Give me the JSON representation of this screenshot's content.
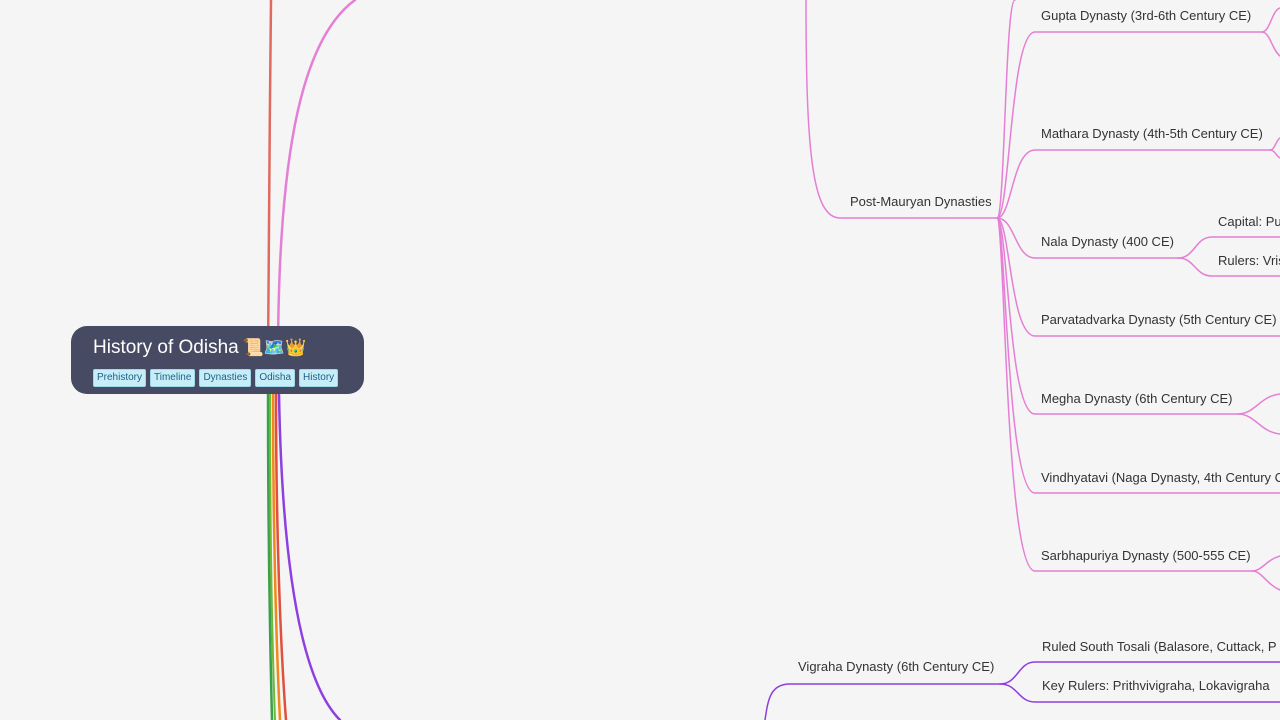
{
  "root": {
    "title": "History of Odisha",
    "emoji": "📜🗺️👑",
    "tags": [
      "Prehistory",
      "Timeline",
      "Dynasties",
      "Odisha",
      "History"
    ]
  },
  "colors": {
    "pink_branch": "#e57fd5",
    "purple_branch": "#8e3fe0",
    "red_branch": "#e06a60",
    "green_branch": "#3aa04a",
    "orange_branch": "#f0891a",
    "root_bg": "#474a63",
    "background": "#f5f5f5"
  },
  "nodes": {
    "post_mauryan": "Post-Mauryan Dynasties",
    "gupta": "Gupta Dynasty (3rd-6th Century CE)",
    "mathara": "Mathara Dynasty (4th-5th Century CE)",
    "nala": "Nala Dynasty (400 CE)",
    "nala_capital": "Capital: Pu",
    "nala_rulers": "Rulers: Vris",
    "parvatadvarka": "Parvatadvarka Dynasty (5th Century CE)",
    "megha": "Megha Dynasty (6th Century CE)",
    "vindhyatavi": "Vindhyatavi (Naga Dynasty, 4th Century C",
    "sarbhapuriya": "Sarbhapuriya Dynasty (500-555 CE)",
    "vigraha": "Vigraha Dynasty (6th Century CE)",
    "vigraha_ruled": "Ruled South Tosali (Balasore, Cuttack, P",
    "vigraha_rulers": "Key Rulers: Prithvivigraha, Lokavigraha"
  }
}
